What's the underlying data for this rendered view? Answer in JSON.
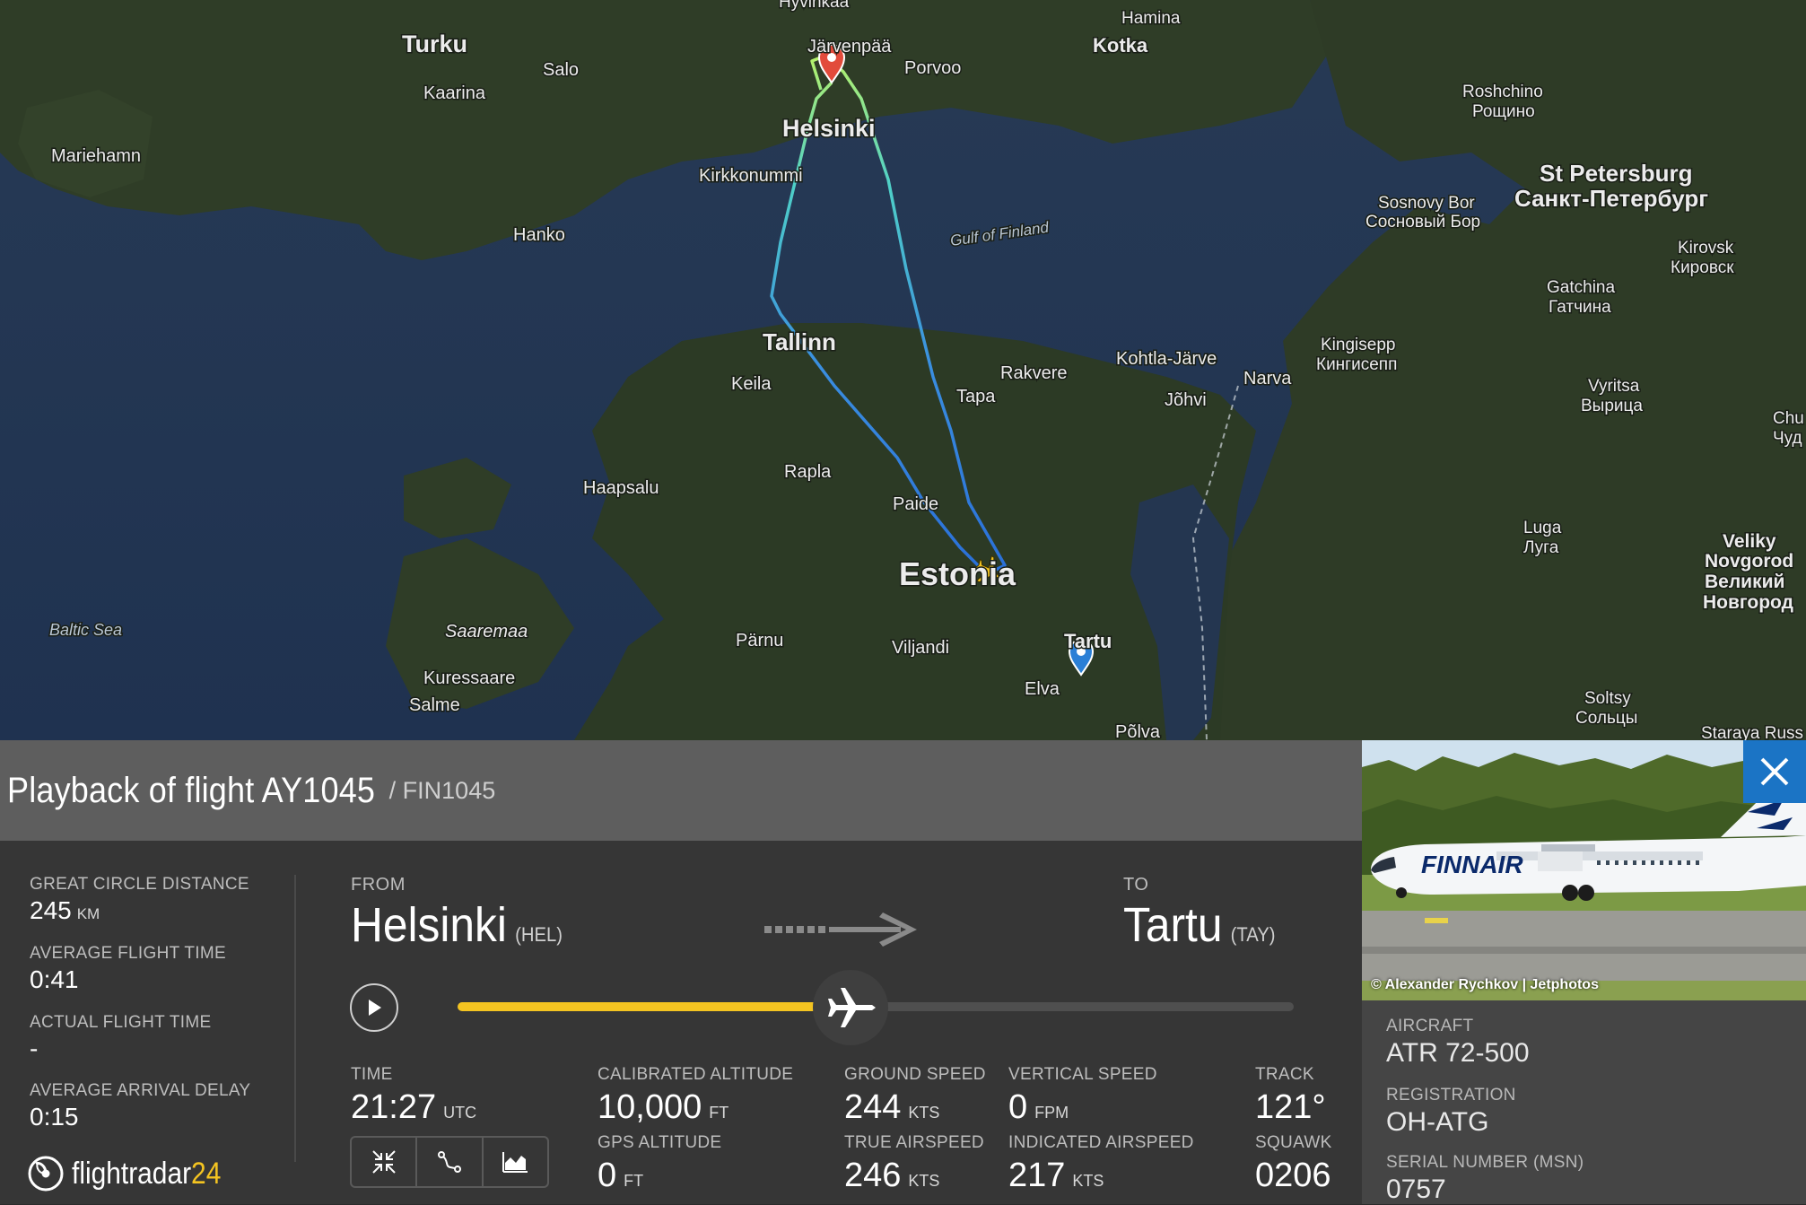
{
  "map": {
    "labels": {
      "turku": "Turku",
      "salo": "Salo",
      "kaarina": "Kaarina",
      "mariehamn": "Mariehamn",
      "hyvinkaa": "Hyvinkää",
      "jarvenpaa": "Järvenpää",
      "porvoo": "Porvoo",
      "hamina": "Hamina",
      "kotka": "Kotka",
      "helsinki": "Helsinki",
      "kirkkonummi": "Kirkkonummi",
      "hanko": "Hanko",
      "gulf": "Gulf of Finland",
      "roshchino": "Roshchino",
      "roshchino_ru": "Рощино",
      "stpete": "St Petersburg",
      "stpete_ru": "Санкт-Петербург",
      "sosnovy": "Sosnovy Bor",
      "sosnovy_ru": "Сосновый Бор",
      "kirovsk": "Kirovsk",
      "kirovsk_ru": "Кировск",
      "gatchina": "Gatchina",
      "gatchina_ru": "Гатчина",
      "kingisepp": "Kingisepp",
      "kingisepp_ru": "Кингисепп",
      "tallinn": "Tallinn",
      "keila": "Keila",
      "rakvere": "Rakvere",
      "kohtla": "Kohtla-Järve",
      "narva": "Narva",
      "tapa": "Tapa",
      "johvi": "Jõhvi",
      "vyritsa": "Vyritsa",
      "vyritsa_ru": "Вырица",
      "chu": "Chu",
      "chu_ru": "Чуд",
      "haapsalu": "Haapsalu",
      "rapla": "Rapla",
      "paide": "Paide",
      "estonia": "Estonia",
      "luga": "Luga",
      "luga_ru": "Луга",
      "veliky1": "Veliky",
      "veliky2": "Novgorod",
      "veliky_ru1": "Великий",
      "veliky_ru2": "Новгород",
      "baltic": "Baltic Sea",
      "saaremaa": "Saaremaa",
      "parnu": "Pärnu",
      "viljandi": "Viljandi",
      "tartu": "Tartu",
      "elva": "Elva",
      "kuressaare": "Kuressaare",
      "salme": "Salme",
      "polva": "Põlva",
      "soltsy": "Soltsy",
      "soltsy_ru": "Сольцы",
      "staraya": "Staraya Russ"
    }
  },
  "header": {
    "title": "Playback of flight AY1045",
    "subtitle": " / FIN1045"
  },
  "stats": {
    "great_circle_label": "GREAT CIRCLE DISTANCE",
    "great_circle_value": "245",
    "great_circle_unit": "KM",
    "avg_flight_label": "AVERAGE FLIGHT TIME",
    "avg_flight_value": "0:41",
    "actual_flight_label": "ACTUAL FLIGHT TIME",
    "actual_flight_value": "-",
    "avg_delay_label": "AVERAGE ARRIVAL DELAY",
    "avg_delay_value": "0:15"
  },
  "route": {
    "from_label": "FROM",
    "from_city": "Helsinki",
    "from_code": "(HEL)",
    "to_label": "TO",
    "to_city": "Tartu",
    "to_code": "(TAY)"
  },
  "playback": {
    "progress": 0.47
  },
  "metrics": {
    "time_label": "TIME",
    "time_value": "21:27",
    "time_unit": "UTC",
    "cal_alt_label": "CALIBRATED ALTITUDE",
    "cal_alt_value": "10,000",
    "cal_alt_unit": "FT",
    "gps_alt_label": "GPS ALTITUDE",
    "gps_alt_value": "0",
    "gps_alt_unit": "FT",
    "gs_label": "GROUND SPEED",
    "gs_value": "244",
    "gs_unit": "KTS",
    "tas_label": "TRUE AIRSPEED",
    "tas_value": "246",
    "tas_unit": "KTS",
    "vs_label": "VERTICAL SPEED",
    "vs_value": "0",
    "vs_unit": "FPM",
    "ias_label": "INDICATED AIRSPEED",
    "ias_value": "217",
    "ias_unit": "KTS",
    "track_label": "TRACK",
    "track_value": "121°",
    "squawk_label": "SQUAWK",
    "squawk_value": "0206"
  },
  "logo": {
    "text": "flightradar",
    "num": "24"
  },
  "aircraft": {
    "photo_credit": "© Alexander Rychkov | Jetphotos",
    "livery_text": "FINNAIR",
    "aircraft_label": "AIRCRAFT",
    "aircraft_value": "ATR 72-500",
    "registration_label": "REGISTRATION",
    "registration_value": "OH-ATG",
    "serial_label": "SERIAL NUMBER (MSN)",
    "serial_value": "0757"
  },
  "colors": {
    "accent": "#f4c421",
    "close_button": "#1b74c5",
    "panel_bg": "#363636",
    "title_bg": "#5e5e5e"
  }
}
